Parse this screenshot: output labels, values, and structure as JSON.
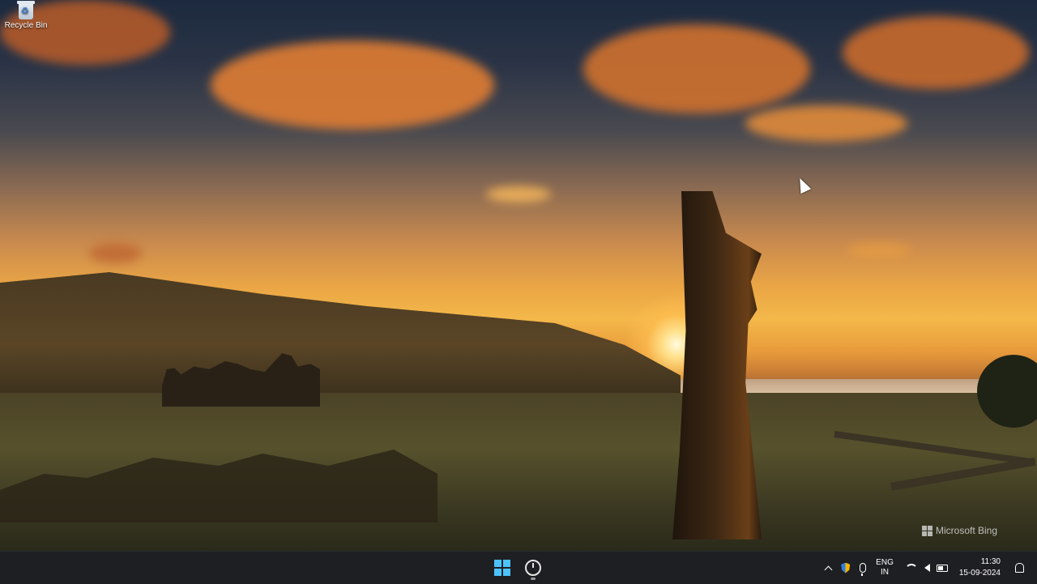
{
  "desktop": {
    "icons": [
      {
        "label": "Recycle Bin",
        "icon": "recycle-bin-icon"
      }
    ],
    "watermark": "Microsoft Bing"
  },
  "taskbar": {
    "pinned": [
      {
        "name": "Start",
        "icon": "windows-start-icon",
        "accent": "#4cc2ff"
      },
      {
        "name": "Clock",
        "icon": "clock-app-icon",
        "running": true
      }
    ],
    "tray": {
      "language_primary": "ENG",
      "language_secondary": "IN",
      "time": "11:30",
      "date": "15-09-2024",
      "icons": [
        "show-hidden-icons-chevron",
        "security-shield-icon",
        "microphone-icon",
        "wifi-icon",
        "volume-icon",
        "battery-icon",
        "notification-bell-icon"
      ]
    }
  }
}
